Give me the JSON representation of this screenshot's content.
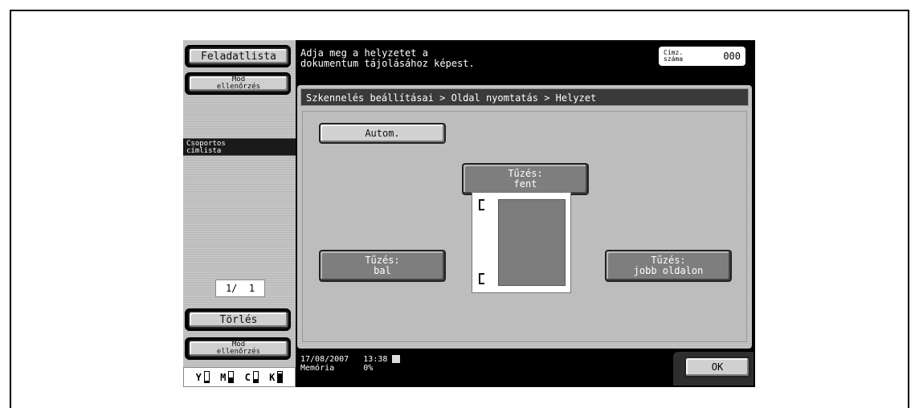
{
  "left_panel": {
    "job_list_label": "Feladatlista",
    "mode_check_label": "Mód\nellenőrzés",
    "group_label": "Csoportos\ncímlista",
    "page_counter": "1/  1",
    "delete_label": "Törlés",
    "mode_check_bottom_label": "Mód\nellenőrzés",
    "toner": [
      {
        "name": "Y",
        "level": 0.15
      },
      {
        "name": "M",
        "level": 0.45
      },
      {
        "name": "C",
        "level": 0.3
      },
      {
        "name": "K",
        "level": 0.85
      }
    ]
  },
  "header": {
    "message": "Adja meg a helyzetet a\ndokumentum tájolásához képest.",
    "address_label": "Címz.\nszáma",
    "address_count": "000"
  },
  "content": {
    "breadcrumb": "Szkennelés beállításai > Oldal nyomtatás > Helyzet",
    "auto_label": "Autom.",
    "top_label": "Tűzés:\nfent",
    "left_label": "Tűzés:\nbal",
    "right_label": "Tűzés:\njobb oldalon"
  },
  "status": {
    "date": "17/08/2007",
    "time": "13:38",
    "memory_label": "Memória",
    "memory_value": "0%"
  },
  "ok_label": "OK"
}
